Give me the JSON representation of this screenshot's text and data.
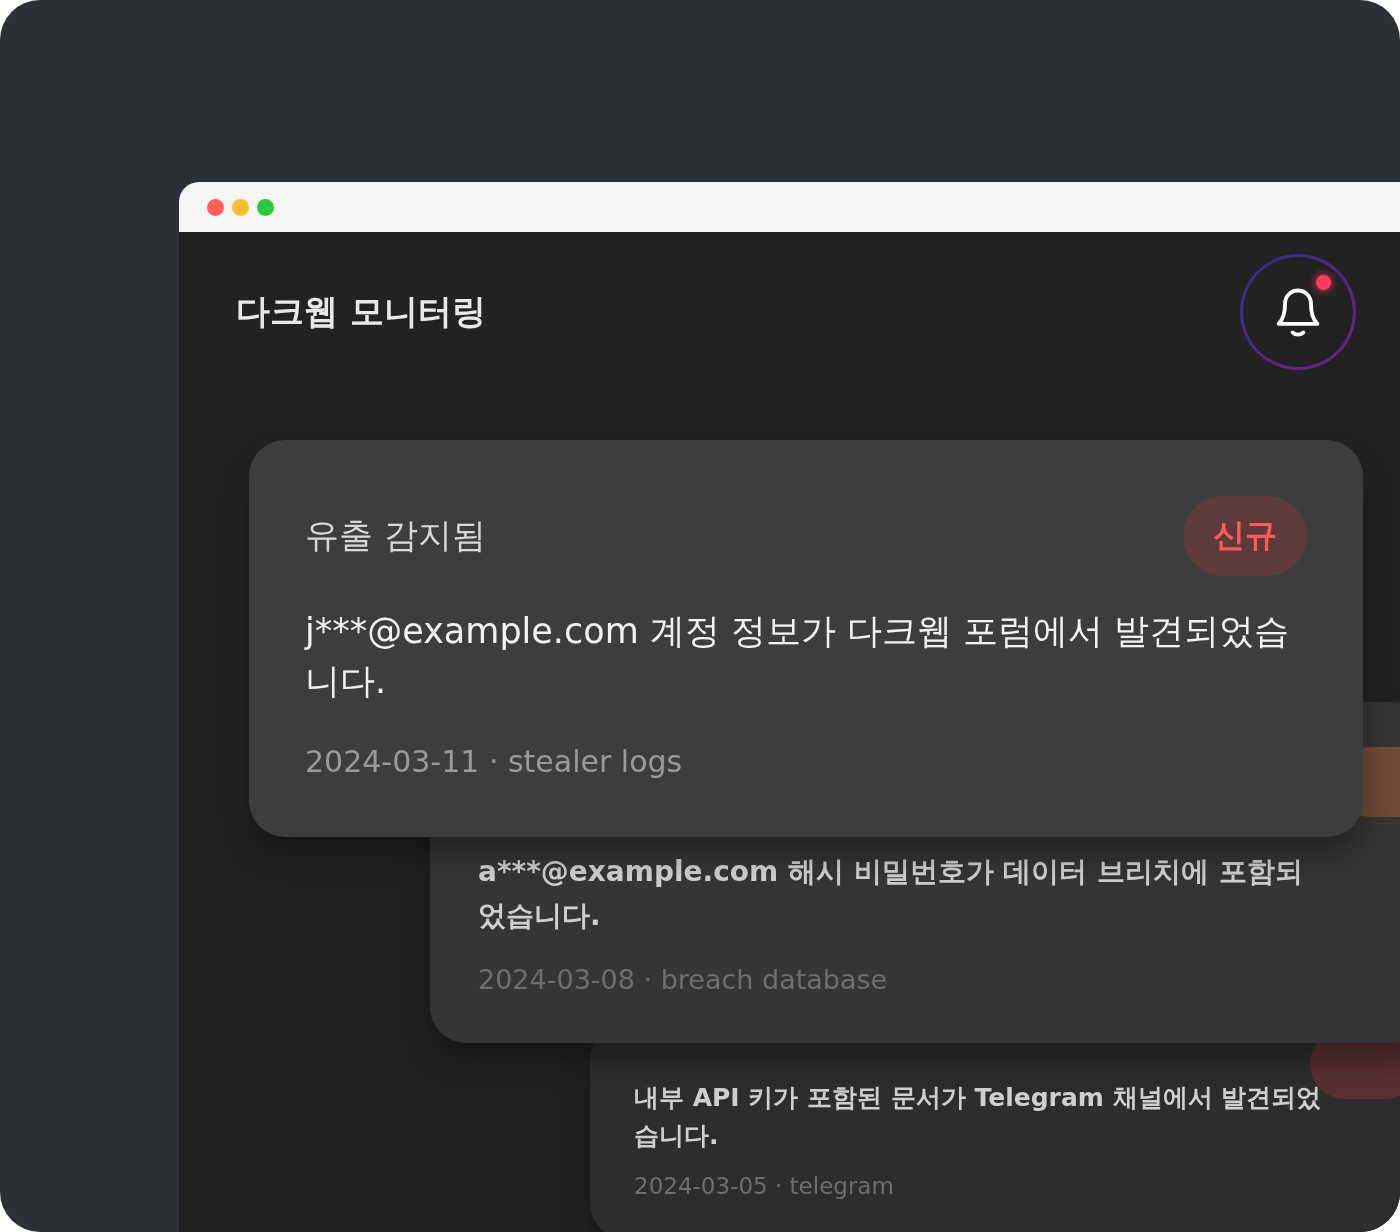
{
  "window": {
    "controls": [
      {
        "kind": "close"
      },
      {
        "kind": "minimize"
      },
      {
        "kind": "zoom"
      }
    ]
  },
  "header": {
    "title": "다크웹 모니터링",
    "notification": {
      "unread": true
    }
  },
  "alerts": [
    {
      "title": "유출 감지됨",
      "badge": {
        "label": "신규",
        "color": "#5e3a3b"
      },
      "message": "j***@example.com 계정 정보가 다크웹 포럼에서 발견되었습니다.",
      "meta": "2024-03-11 · stealer logs"
    },
    {
      "badge": {
        "color": "#6e4a38"
      },
      "message": "a***@example.com 해시 비밀번호가 데이터 브리치에 포함되었습니다.",
      "meta": "2024-03-08 · breach database"
    },
    {
      "badge": {
        "color": "#5a2f30"
      },
      "message": "내부 API 키가 포함된 문서가 Telegram 채널에서 발견되었습니다.",
      "meta": "2024-03-05 · telegram"
    }
  ]
}
